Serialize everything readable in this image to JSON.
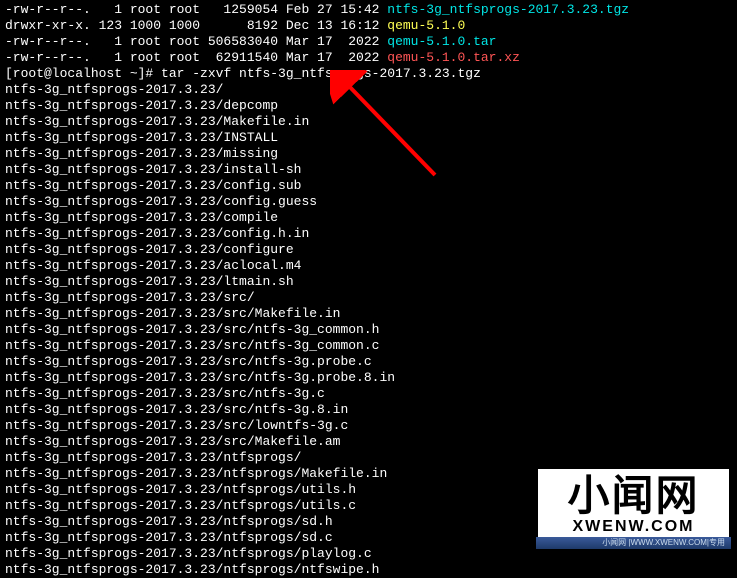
{
  "listing": [
    {
      "perms": "-rw-r--r--.",
      "links": "1",
      "owner": "root",
      "group": "root",
      "size": "1259054",
      "date": "Feb 27 15:42",
      "name": "ntfs-3g_ntfsprogs-2017.3.23.tgz",
      "cls": "cyan"
    },
    {
      "perms": "drwxr-xr-x.",
      "links": "123",
      "owner": "1000",
      "group": "1000",
      "size": "8192",
      "date": "Dec 13 16:12",
      "name": "qemu-5.1.0",
      "cls": "yellow"
    },
    {
      "perms": "-rw-r--r--.",
      "links": "1",
      "owner": "root",
      "group": "root",
      "size": "506583040",
      "date": "Mar 17  2022",
      "name": "qemu-5.1.0.tar",
      "cls": "cyan"
    },
    {
      "perms": "-rw-r--r--.",
      "links": "1",
      "owner": "root",
      "group": "root",
      "size": "62911540",
      "date": "Mar 17  2022",
      "name": "qemu-5.1.0.tar.xz",
      "cls": "red"
    }
  ],
  "prompt": "[root@localhost ~]# ",
  "command": "tar -zxvf ntfs-3g_ntfsprogs-2017.3.23.tgz",
  "output": [
    "ntfs-3g_ntfsprogs-2017.3.23/",
    "ntfs-3g_ntfsprogs-2017.3.23/depcomp",
    "ntfs-3g_ntfsprogs-2017.3.23/Makefile.in",
    "ntfs-3g_ntfsprogs-2017.3.23/INSTALL",
    "ntfs-3g_ntfsprogs-2017.3.23/missing",
    "ntfs-3g_ntfsprogs-2017.3.23/install-sh",
    "ntfs-3g_ntfsprogs-2017.3.23/config.sub",
    "ntfs-3g_ntfsprogs-2017.3.23/config.guess",
    "ntfs-3g_ntfsprogs-2017.3.23/compile",
    "ntfs-3g_ntfsprogs-2017.3.23/config.h.in",
    "ntfs-3g_ntfsprogs-2017.3.23/configure",
    "ntfs-3g_ntfsprogs-2017.3.23/aclocal.m4",
    "ntfs-3g_ntfsprogs-2017.3.23/ltmain.sh",
    "ntfs-3g_ntfsprogs-2017.3.23/src/",
    "ntfs-3g_ntfsprogs-2017.3.23/src/Makefile.in",
    "ntfs-3g_ntfsprogs-2017.3.23/src/ntfs-3g_common.h",
    "ntfs-3g_ntfsprogs-2017.3.23/src/ntfs-3g_common.c",
    "ntfs-3g_ntfsprogs-2017.3.23/src/ntfs-3g.probe.c",
    "ntfs-3g_ntfsprogs-2017.3.23/src/ntfs-3g.probe.8.in",
    "ntfs-3g_ntfsprogs-2017.3.23/src/ntfs-3g.c",
    "ntfs-3g_ntfsprogs-2017.3.23/src/ntfs-3g.8.in",
    "ntfs-3g_ntfsprogs-2017.3.23/src/lowntfs-3g.c",
    "ntfs-3g_ntfsprogs-2017.3.23/src/Makefile.am",
    "ntfs-3g_ntfsprogs-2017.3.23/ntfsprogs/",
    "ntfs-3g_ntfsprogs-2017.3.23/ntfsprogs/Makefile.in",
    "ntfs-3g_ntfsprogs-2017.3.23/ntfsprogs/utils.h",
    "ntfs-3g_ntfsprogs-2017.3.23/ntfsprogs/utils.c",
    "ntfs-3g_ntfsprogs-2017.3.23/ntfsprogs/sd.h",
    "ntfs-3g_ntfsprogs-2017.3.23/ntfsprogs/sd.c",
    "ntfs-3g_ntfsprogs-2017.3.23/ntfsprogs/playlog.c",
    "ntfs-3g_ntfsprogs-2017.3.23/ntfsprogs/ntfswipe.h"
  ],
  "watermark": {
    "main": "小闻网",
    "sub": "XWENW.COM",
    "strip": "小闻网 |WWW.XWENW.COM|专用"
  }
}
